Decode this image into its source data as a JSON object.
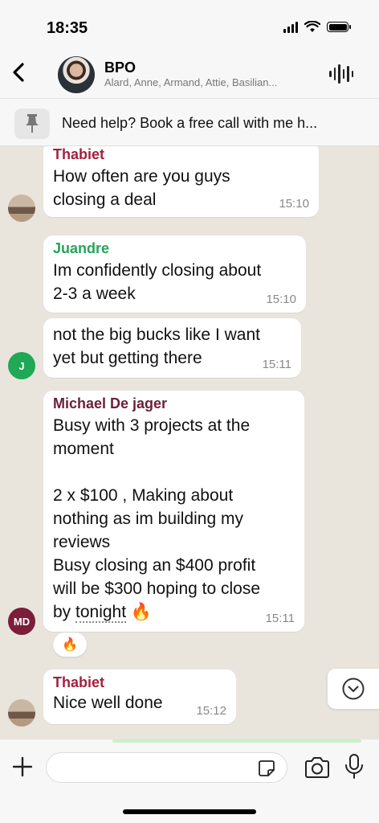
{
  "status_bar": {
    "time": "18:35"
  },
  "header": {
    "title": "BPO",
    "subtitle": "Alard, Anne, Armand, Attie, Basilian..."
  },
  "pinned": {
    "text": "Need help? Book a free call with me h..."
  },
  "messages": [
    {
      "sender": "Thabiet",
      "sender_color": "#a3213e",
      "text": "How often are you guys\nclosing a deal",
      "time": "15:10"
    },
    {
      "sender": "Juandre",
      "sender_color": "#27a35a",
      "text": "Im confidently closing about\n2-3 a week",
      "time": "15:10"
    },
    {
      "sender": "",
      "text": "not the big bucks like I want\nyet but getting there",
      "time": "15:11",
      "avatar": "J",
      "avatar_color": "#1fa855"
    },
    {
      "sender": "Michael De jager",
      "sender_color": "#6b1f3b",
      "text_a": "Busy with 3 projects at the\nmoment\n\n2 x $100 , Making about\nnothing as im building my\nreviews\nBusy closing an $400 profit\nwill be $300 hoping to close\nby ",
      "text_b": "tonight",
      "text_c": " 🔥",
      "time": "15:11",
      "avatar": "MD",
      "avatar_color": "#7a1e3a"
    },
    {
      "sender": "Thabiet",
      "sender_color": "#a3213e",
      "text": "Nice well done",
      "time": "15:12"
    }
  ],
  "reaction": "🔥",
  "composer": {
    "placeholder": ""
  },
  "colors": {
    "accent_green": "#25d366",
    "chat_bg": "#e9e4dc"
  }
}
